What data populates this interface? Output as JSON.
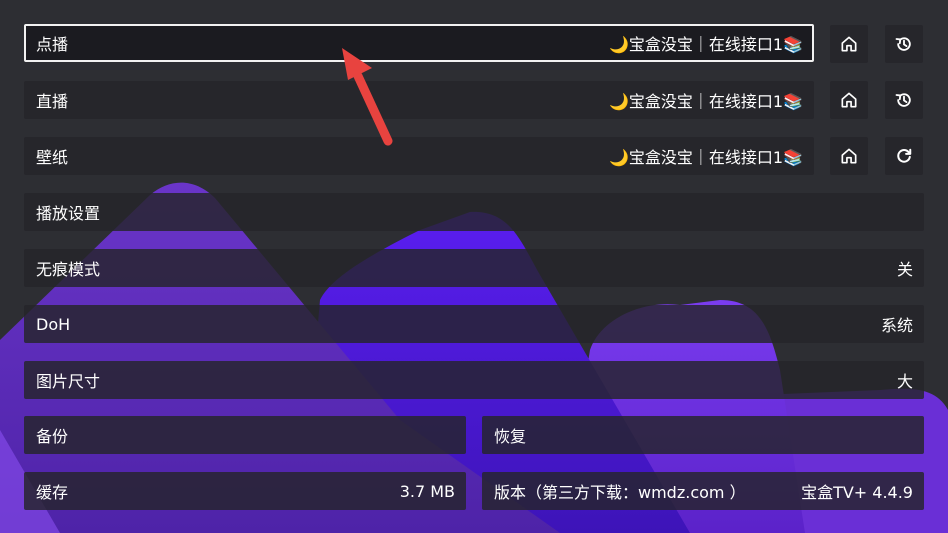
{
  "colors": {
    "background": "#2d2e33",
    "row_background": "#24252a",
    "focus_border": "#f2f2f2",
    "accent_purple": "#7b2ff2",
    "annotation_arrow": "#e8433f"
  },
  "rows": {
    "vod": {
      "label": "点播",
      "value": "🌙宝盒没宝｜在线接口1📚"
    },
    "live": {
      "label": "直播",
      "value": "🌙宝盒没宝｜在线接口1📚"
    },
    "wallpaper": {
      "label": "壁纸",
      "value": "🌙宝盒没宝｜在线接口1📚"
    },
    "playback": {
      "label": "播放设置"
    },
    "incognito": {
      "label": "无痕模式",
      "value": "关"
    },
    "doh": {
      "label": "DoH",
      "value": "系统"
    },
    "image_size": {
      "label": "图片尺寸",
      "value": "大"
    },
    "backup": {
      "label": "备份"
    },
    "restore": {
      "label": "恢复"
    },
    "cache": {
      "label": "缓存",
      "value": "3.7 MB"
    },
    "version": {
      "label": "版本（第三方下载：wmdz.com ）",
      "value": "宝盒TV+ 4.4.9"
    }
  },
  "icons": {
    "home": "home-icon",
    "history": "history-icon",
    "refresh": "refresh-icon",
    "arrow": "annotation-arrow"
  }
}
